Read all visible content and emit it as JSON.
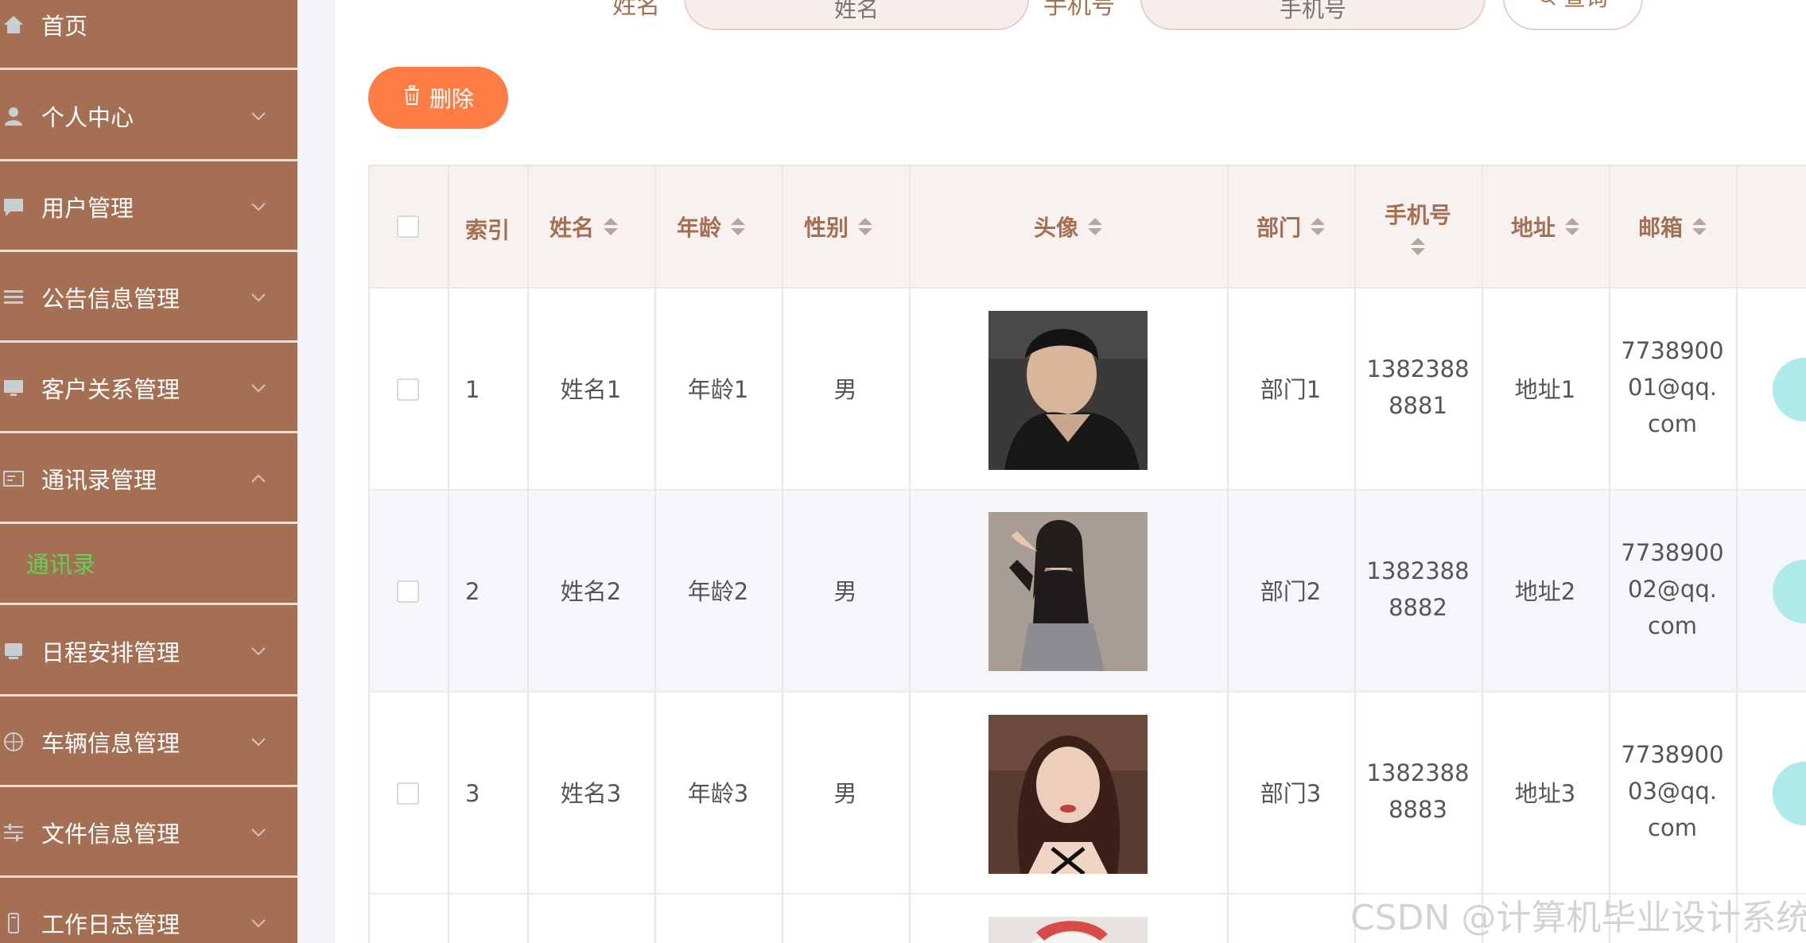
{
  "sidebar": {
    "items": [
      {
        "label": "首页",
        "icon": "home-icon",
        "has_arrow": false
      },
      {
        "label": "个人中心",
        "icon": "user-icon",
        "has_arrow": true
      },
      {
        "label": "用户管理",
        "icon": "chat-icon",
        "has_arrow": true
      },
      {
        "label": "公告信息管理",
        "icon": "list-icon",
        "has_arrow": true
      },
      {
        "label": "客户关系管理",
        "icon": "monitor-icon",
        "has_arrow": true
      },
      {
        "label": "通讯录管理",
        "icon": "card-icon",
        "has_arrow": true,
        "expanded": true
      },
      {
        "label": "日程安排管理",
        "icon": "screen-icon",
        "has_arrow": true
      },
      {
        "label": "车辆信息管理",
        "icon": "compass-icon",
        "has_arrow": true
      },
      {
        "label": "文件信息管理",
        "icon": "sliders-icon",
        "has_arrow": true
      },
      {
        "label": "工作日志管理",
        "icon": "phone-icon",
        "has_arrow": true
      }
    ],
    "submenu": {
      "label": "通讯录",
      "color": "#5fd35a"
    }
  },
  "search": {
    "name_label": "姓名",
    "name_placeholder": "姓名",
    "phone_label": "手机号",
    "phone_placeholder": "手机号",
    "query_label": "查询"
  },
  "toolbar": {
    "delete_label": "删除"
  },
  "table": {
    "headers": {
      "index": "索引",
      "name": "姓名",
      "age": "年龄",
      "gender": "性别",
      "avatar": "头像",
      "dept": "部门",
      "phone": "手机号",
      "address": "地址",
      "email": "邮箱"
    },
    "rows": [
      {
        "index": "1",
        "name": "姓名1",
        "age": "年龄1",
        "gender": "男",
        "dept": "部门1",
        "phone_l1": "1382388",
        "phone_l2": "8881",
        "address": "地址1",
        "email_l1": "7738900",
        "email_l2": "01@qq.",
        "email_l3": "com"
      },
      {
        "index": "2",
        "name": "姓名2",
        "age": "年龄2",
        "gender": "男",
        "dept": "部门2",
        "phone_l1": "1382388",
        "phone_l2": "8882",
        "address": "地址2",
        "email_l1": "7738900",
        "email_l2": "02@qq.",
        "email_l3": "com"
      },
      {
        "index": "3",
        "name": "姓名3",
        "age": "年龄3",
        "gender": "男",
        "dept": "部门3",
        "phone_l1": "1382388",
        "phone_l2": "8883",
        "address": "地址3",
        "email_l1": "7738900",
        "email_l2": "03@qq.",
        "email_l3": "com"
      }
    ]
  },
  "watermark": "CSDN @计算机毕业设计系统",
  "colors": {
    "sidebar_bg": "#a56f54",
    "accent_text": "#a56f54",
    "delete_btn": "#ff7c45",
    "action_btn": "#aeeae9",
    "header_bg": "#f7f2f0"
  }
}
